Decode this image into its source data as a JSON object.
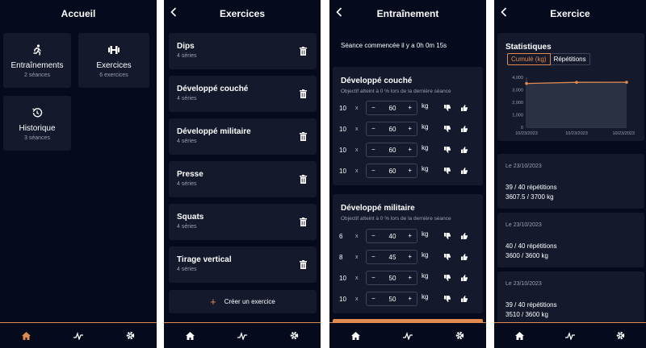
{
  "colors": {
    "accent": "#e08a50",
    "background": "#050a1c",
    "card": "#141a2c"
  },
  "home": {
    "title": "Accueil",
    "tiles": [
      {
        "icon": "running-icon",
        "label": "Entraînements",
        "sub": "2 séances"
      },
      {
        "icon": "dumbbell-icon",
        "label": "Exercices",
        "sub": "6 exercices"
      },
      {
        "icon": "history-icon",
        "label": "Historique",
        "sub": "3 séances"
      }
    ]
  },
  "exercises": {
    "title": "Exercices",
    "items": [
      {
        "name": "Dips",
        "sets": "4 séries"
      },
      {
        "name": "Développé couché",
        "sets": "4 séries"
      },
      {
        "name": "Développé militaire",
        "sets": "4 séries"
      },
      {
        "name": "Presse",
        "sets": "4 séries"
      },
      {
        "name": "Squats",
        "sets": "4 séries"
      },
      {
        "name": "Tirage vertical",
        "sets": "4 séries"
      }
    ],
    "create_label": "Créer un exercice"
  },
  "workout": {
    "title": "Entraînement",
    "started": "Séance commencée il y a 0h 0m 15s",
    "x_label": "x",
    "kg_label": "kg",
    "blocks": [
      {
        "name": "Développé couché",
        "objective": "Objectif atteint à 0 % lors de la dernière séance",
        "sets": [
          {
            "reps": "10",
            "weight": "60"
          },
          {
            "reps": "10",
            "weight": "60"
          },
          {
            "reps": "10",
            "weight": "60"
          },
          {
            "reps": "10",
            "weight": "60"
          }
        ]
      },
      {
        "name": "Développé militaire",
        "objective": "Objectif atteint à 0 % lors de la dernière séance",
        "sets": [
          {
            "reps": "6",
            "weight": "40"
          },
          {
            "reps": "8",
            "weight": "45"
          },
          {
            "reps": "10",
            "weight": "50"
          },
          {
            "reps": "10",
            "weight": "50"
          }
        ]
      }
    ]
  },
  "exercise_detail": {
    "title": "Exercice",
    "stats_title": "Statistiques",
    "toggle": {
      "active": "Cumulé (kg)",
      "inactive": "Répétitions"
    },
    "history": [
      {
        "date": "Le 23/10/2023",
        "reps": "39 / 40 répétitions",
        "kg": "3607.5 / 3700 kg"
      },
      {
        "date": "Le 23/10/2023",
        "reps": "40 / 40 répétitions",
        "kg": "3600 / 3600 kg"
      },
      {
        "date": "Le 23/10/2023",
        "reps": "39 / 40 répétitions",
        "kg": "3510 / 3600 kg"
      }
    ]
  },
  "chart_data": {
    "type": "area",
    "categories": [
      "10/23/2023",
      "10/23/2023",
      "10/23/2023"
    ],
    "series": [
      {
        "values": [
          3510,
          3600,
          3607.5
        ]
      }
    ],
    "yticks": [
      "0",
      "1,000",
      "2,000",
      "3,000",
      "4,000"
    ],
    "ylim": [
      0,
      4000
    ]
  }
}
